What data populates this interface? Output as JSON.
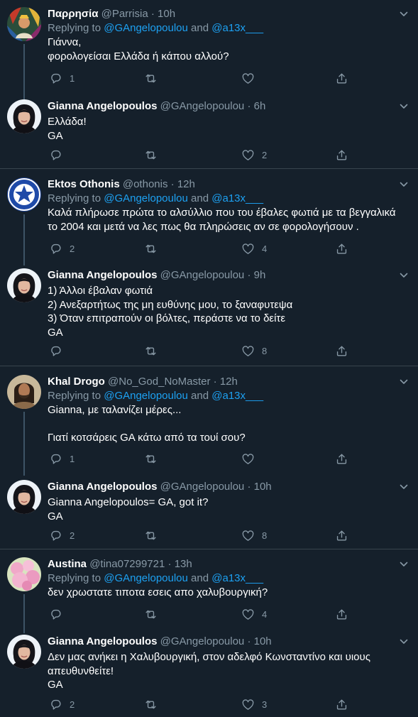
{
  "icons": {
    "reply": "reply-icon",
    "retweet": "retweet-icon",
    "like": "heart-icon",
    "share": "share-icon",
    "more": "chevron-down-icon"
  },
  "colors": {
    "background": "#15202b",
    "accent": "#1da1f2",
    "muted": "#8899a6",
    "divider": "#38444d"
  },
  "tweets": [
    {
      "name": "Παρρησία",
      "handle": "@Parrisia",
      "dot": "·",
      "time": "10h",
      "replying_prefix": "Replying to ",
      "mention1": "@GAngelopoulou",
      "and": " and ",
      "mention2": "@a13x___",
      "text": "Γιάννα,\nφορολογείσαι Ελλάδα ή κάπου αλλού?",
      "replies": "1",
      "retweets": "",
      "likes": ""
    },
    {
      "name": "Gianna Angelopoulos",
      "handle": "@GAngelopoulou",
      "dot": "·",
      "time": "6h",
      "text": "Ελλάδα!\nGA",
      "replies": "",
      "retweets": "",
      "likes": "2"
    },
    {
      "name": "Ektos Othonis",
      "handle": "@othonis",
      "dot": "·",
      "time": "12h",
      "replying_prefix": "Replying to ",
      "mention1": "@GAngelopoulou",
      "and": " and ",
      "mention2": "@a13x___",
      "text": "Καλά πλήρωσε πρώτα το αλσύλλιο που του έβαλες φωτιά με τα βεγγαλικά\nτο 2004 και μετά να λες πως θα πληρώσεις αν σε φορολογήσουν .",
      "replies": "2",
      "retweets": "",
      "likes": "4"
    },
    {
      "name": "Gianna Angelopoulos",
      "handle": "@GAngelopoulou",
      "dot": "·",
      "time": "9h",
      "text": "1) Άλλοι έβαλαν φωτιά\n2) Ανεξαρτήτως της μη ευθύνης μου, το ξαναφυτεψα\n3) Όταν επιτραπούν οι βόλτες, περάστε να το δείτε\nGA",
      "replies": "",
      "retweets": "",
      "likes": "8"
    },
    {
      "name": "Khal Drogo",
      "handle": "@No_God_NoMaster",
      "dot": "·",
      "time": "12h",
      "replying_prefix": "Replying to ",
      "mention1": "@GAngelopoulou",
      "and": " and ",
      "mention2": "@a13x___",
      "text": "Gianna, με ταλανίζει μέρες...\n\nΓιατί κοτσάρεις GA κάτω από τα τουί σου?",
      "replies": "1",
      "retweets": "",
      "likes": ""
    },
    {
      "name": "Gianna Angelopoulos",
      "handle": "@GAngelopoulou",
      "dot": "·",
      "time": "10h",
      "text": "Gianna Angelopoulos= GA, got it?\nGA",
      "replies": "2",
      "retweets": "",
      "likes": "8"
    },
    {
      "name": "Austina",
      "handle": "@tina07299721",
      "dot": "·",
      "time": "13h",
      "replying_prefix": "Replying to ",
      "mention1": "@GAngelopoulou",
      "and": " and ",
      "mention2": "@a13x___",
      "text": "δεν χρωστατε τιποτα εσεις απο χαλυβουργική?",
      "replies": "",
      "retweets": "",
      "likes": "4"
    },
    {
      "name": "Gianna Angelopoulos",
      "handle": "@GAngelopoulou",
      "dot": "·",
      "time": "10h",
      "text": "Δεν μας ανήκει η Χαλυβουργική, στον αδελφό Κωνσταντίνο και υιους\nαπευθυνθείτε!\nGA",
      "replies": "2",
      "retweets": "",
      "likes": "3"
    }
  ]
}
